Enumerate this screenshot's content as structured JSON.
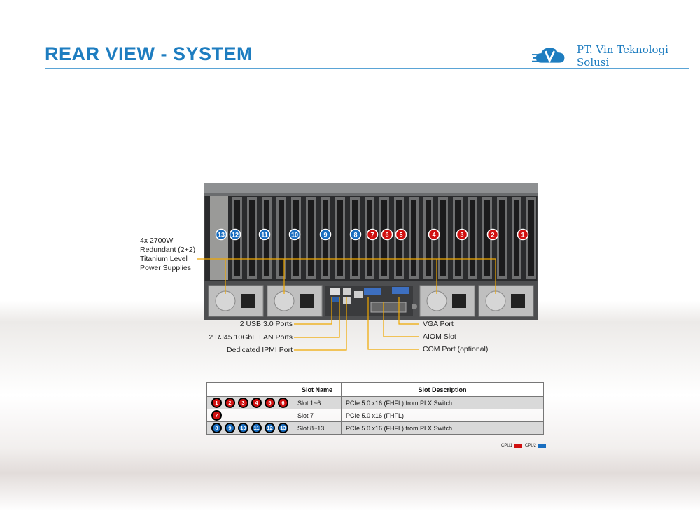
{
  "title": "REAR VIEW - SYSTEM",
  "logo": {
    "text": "PT. Vin Teknologi Solusi",
    "icon": "cloud-v-logo-icon"
  },
  "colors": {
    "accent": "#1e7dc0",
    "cpu1": "#d01010",
    "cpu2": "#1a6ec0"
  },
  "slot_badges": [
    {
      "n": "13",
      "cpu": "cpu2"
    },
    {
      "n": "12",
      "cpu": "cpu2"
    },
    {
      "n": "11",
      "cpu": "cpu2"
    },
    {
      "n": "10",
      "cpu": "cpu2"
    },
    {
      "n": "9",
      "cpu": "cpu2"
    },
    {
      "n": "8",
      "cpu": "cpu2"
    },
    {
      "n": "7",
      "cpu": "cpu1"
    },
    {
      "n": "6",
      "cpu": "cpu1"
    },
    {
      "n": "5",
      "cpu": "cpu1"
    },
    {
      "n": "4",
      "cpu": "cpu1"
    },
    {
      "n": "3",
      "cpu": "cpu1"
    },
    {
      "n": "2",
      "cpu": "cpu1"
    },
    {
      "n": "1",
      "cpu": "cpu1"
    }
  ],
  "callouts": {
    "psu": "4x 2700W Redundant (2+2) Titanium Level Power Supplies",
    "usb": "2 USB 3.0 Ports",
    "lan": "2 RJ45 10GbE LAN Ports",
    "ipmi": "Dedicated IPMI  Port",
    "vga": "VGA Port",
    "aiom": "AIOM Slot",
    "com": "COM Port (optional)"
  },
  "table": {
    "headers": [
      "",
      "Slot Name",
      "Slot Description"
    ],
    "rows": [
      {
        "badges": [
          "1",
          "2",
          "3",
          "4",
          "5",
          "6"
        ],
        "cpu": "cpu1",
        "name": "Slot 1~6",
        "desc": "PCIe 5.0 x16 (FHFL) from PLX Switch"
      },
      {
        "badges": [
          "7"
        ],
        "cpu": "cpu1",
        "name": "Slot 7",
        "desc": "PCIe 5.0 x16 (FHFL)"
      },
      {
        "badges": [
          "8",
          "9",
          "10",
          "11",
          "12",
          "13"
        ],
        "cpu": "cpu2",
        "name": "Slot 8~13",
        "desc": "PCIe 5.0 x16 (FHFL) from PLX Switch"
      }
    ]
  },
  "legend": {
    "cpu1": "CPU1",
    "cpu2": "CPU2"
  }
}
